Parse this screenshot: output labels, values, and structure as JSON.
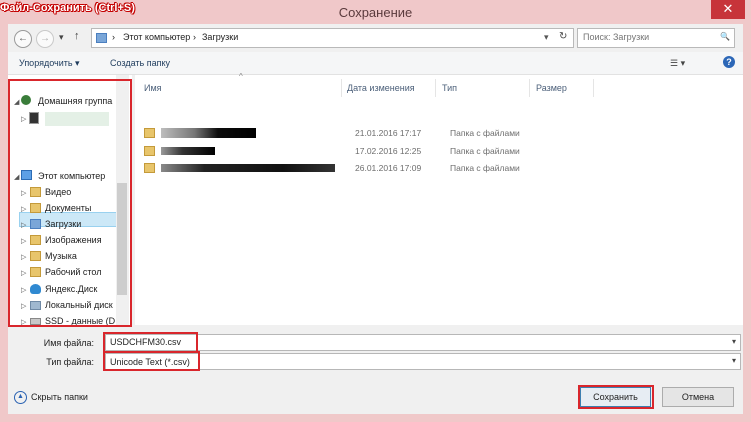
{
  "annotation": {
    "caption": "Файл-Сохранить (Ctrl+S)"
  },
  "window": {
    "title": "Сохранение",
    "close_glyph": "✕"
  },
  "nav": {
    "back_glyph": "←",
    "forward_glyph": "→",
    "recent_glyph": "▾",
    "up_glyph": "↑",
    "address": [
      "Этот компьютер",
      "Загрузки"
    ],
    "address_sep": "›",
    "address_lead": "›",
    "refresh_glyph": "↻",
    "dropdown_glyph": "▾",
    "search_placeholder": "Поиск: Загрузки",
    "search_glyph": "🔍"
  },
  "toolbar": {
    "organize_label": "Упорядочить ▾",
    "new_folder_label": "Создать папку",
    "view_glyph": "☰ ▾",
    "help_glyph": "?"
  },
  "tree": {
    "homegroup": "Домашняя группа",
    "computer": "Этот компьютер",
    "items": [
      "Видео",
      "Документы",
      "Загрузки",
      "Изображения",
      "Музыка",
      "Рабочий стол",
      "Яндекс.Диск",
      "Локальный диск",
      "SSD - данные (D"
    ],
    "expand_glyph": "◢",
    "collapsed_glyph": "▷"
  },
  "files": {
    "columns": {
      "name": "Имя",
      "date": "Дата изменения",
      "type": "Тип",
      "size": "Размер"
    },
    "sort_glyph": "^",
    "rows": [
      {
        "date": "21.01.2016 17:17",
        "type": "Папка с файлами"
      },
      {
        "date": "17.02.2016 12:25",
        "type": "Папка с файлами"
      },
      {
        "date": "26.01.2016 17:09",
        "type": "Папка с файлами"
      }
    ]
  },
  "form": {
    "filename_label": "Имя файла:",
    "filename_value": "USDCHFM30.csv",
    "filetype_label": "Тип файла:",
    "filetype_value": "Unicode Text (*.csv)",
    "dropdown_glyph": "▾"
  },
  "footer": {
    "hide_folders_label": "Скрыть папки",
    "hide_glyph": "▲",
    "save_label": "Сохранить",
    "cancel_label": "Отмена"
  }
}
